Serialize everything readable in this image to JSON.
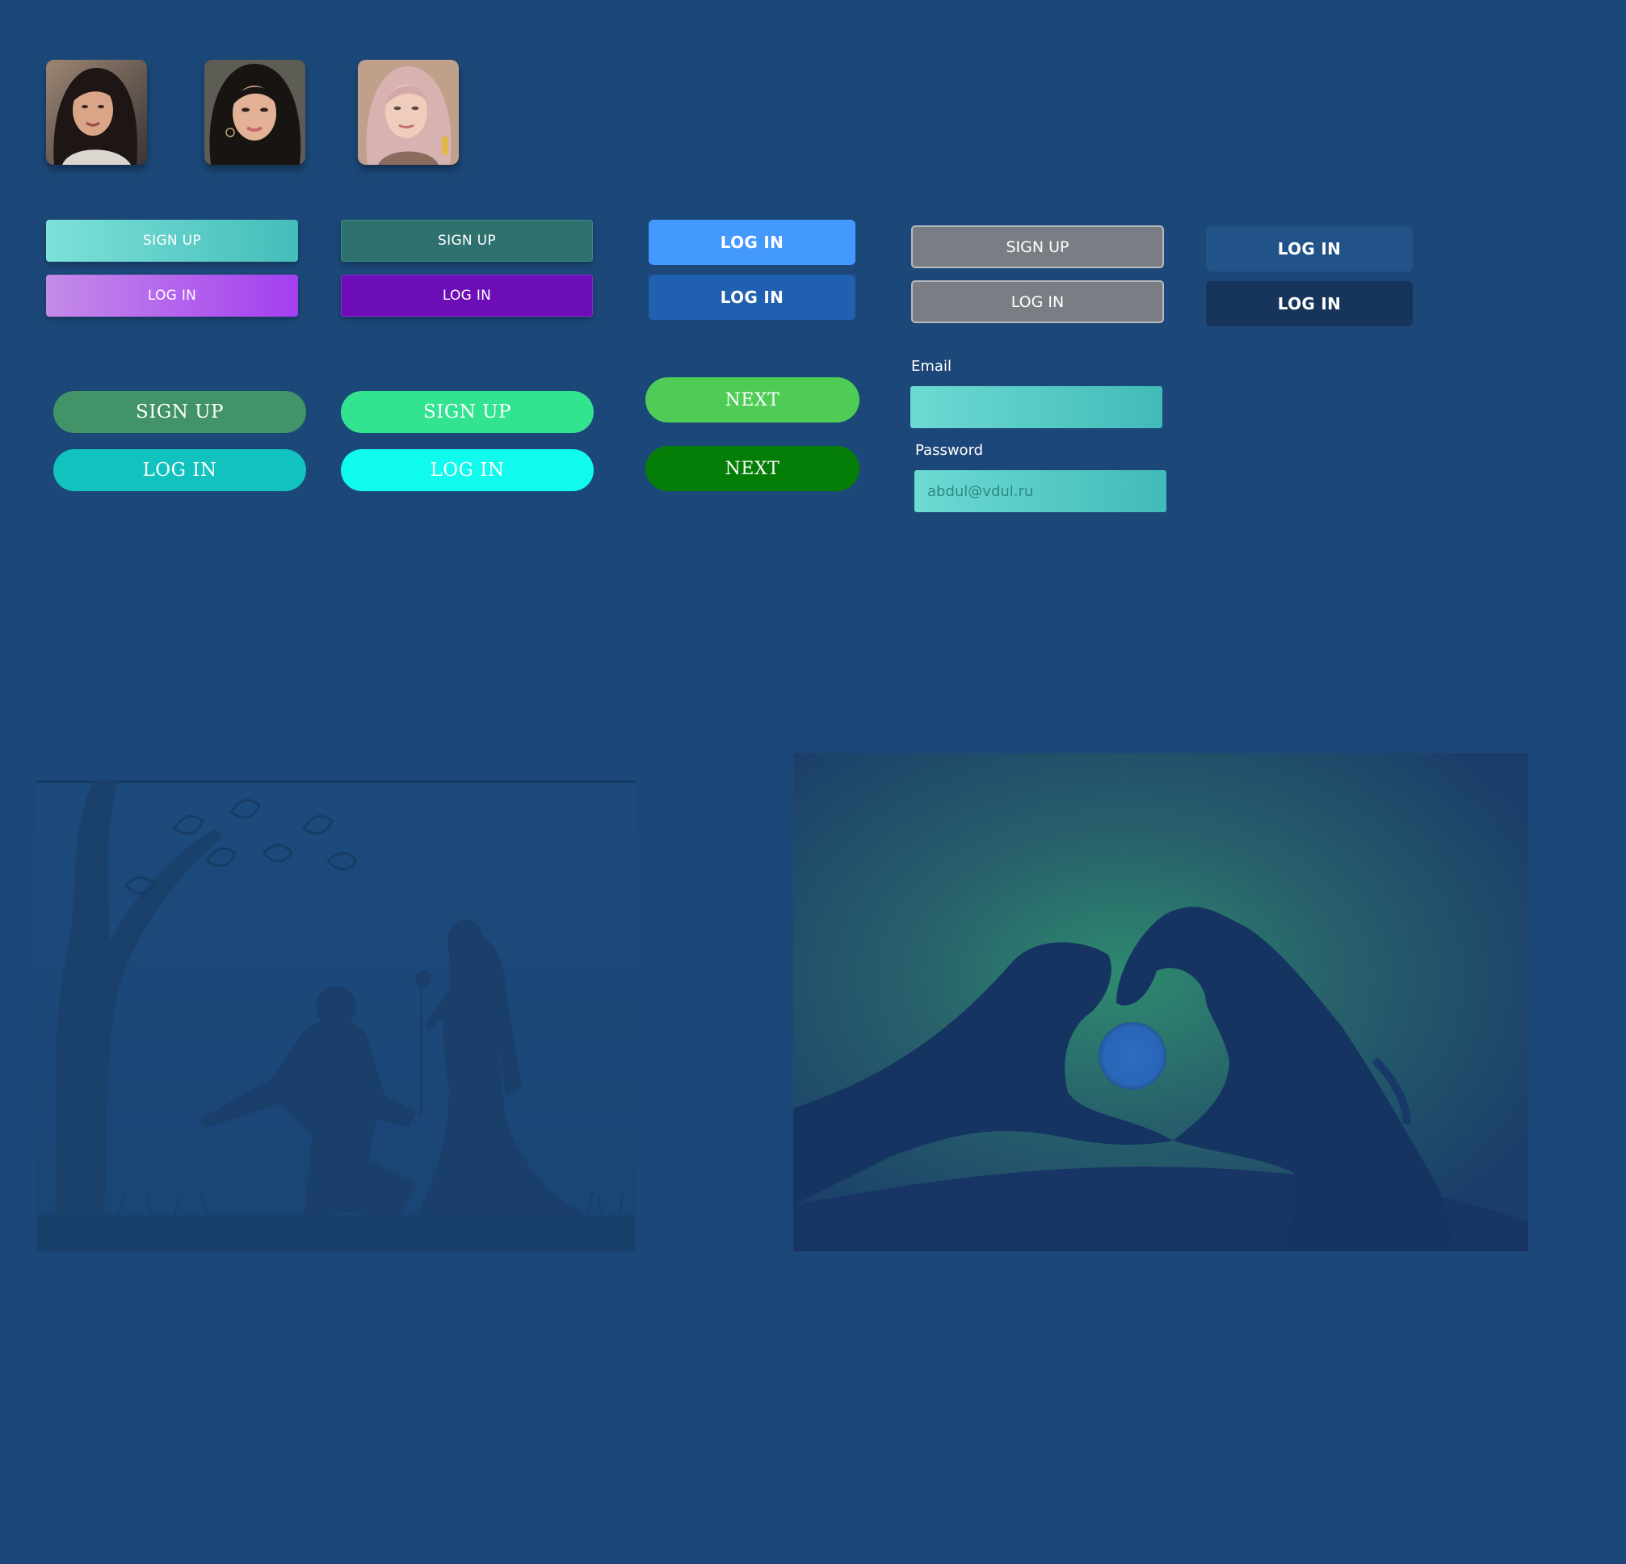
{
  "colors": {
    "background": "#1c4879",
    "signup_gradient_1": [
      "#7de1d9",
      "#44bdb9"
    ],
    "login_gradient_1": [
      "#c48be9",
      "#a43ff0"
    ],
    "signup_2": "#2e716e",
    "login_2": "#6c0db8",
    "login_blue_1": "#4499fe",
    "login_blue_2": "#2060b0",
    "login_navy_1": "#215288",
    "login_navy_2": "#17345a",
    "pill_signup_1": "#439368",
    "pill_login_1": "#11c2be",
    "pill_signup_2": "#32e490",
    "pill_login_2": "#10faee",
    "next_1": "#4fcc56",
    "next_2": "#057e08"
  },
  "avatars": [
    {
      "name": "woman-avatar-1"
    },
    {
      "name": "woman-avatar-2"
    },
    {
      "name": "woman-avatar-3"
    }
  ],
  "buttons": {
    "group1": {
      "signup": "SIGN UP",
      "login": "LOG IN"
    },
    "group2": {
      "signup": "SIGN UP",
      "login": "LOG IN"
    },
    "group3": {
      "login_top": "LOG IN",
      "login_bottom": "LOG IN"
    },
    "group4": {
      "signup": "SIGN UP",
      "login": "LOG IN"
    },
    "group5": {
      "login_top": "LOG IN",
      "login_bottom": "LOG IN"
    },
    "pills1": {
      "signup": "SIGN UP",
      "login": "LOG IN"
    },
    "pills2": {
      "signup": "SIGN UP",
      "login": "LOG IN"
    },
    "next": {
      "top": "NEXT",
      "bottom": "NEXT"
    }
  },
  "form": {
    "email_label": "Email",
    "email_value": "",
    "password_label": "Password",
    "password_placeholder": "abdul@vdul.ru"
  },
  "illustrations": [
    {
      "name": "proposal-silhouette-illustration",
      "subject": "man kneeling offering rose to woman under tree"
    },
    {
      "name": "heart-hands-moon-illustration",
      "subject": "two hands forming heart around moon"
    }
  ]
}
